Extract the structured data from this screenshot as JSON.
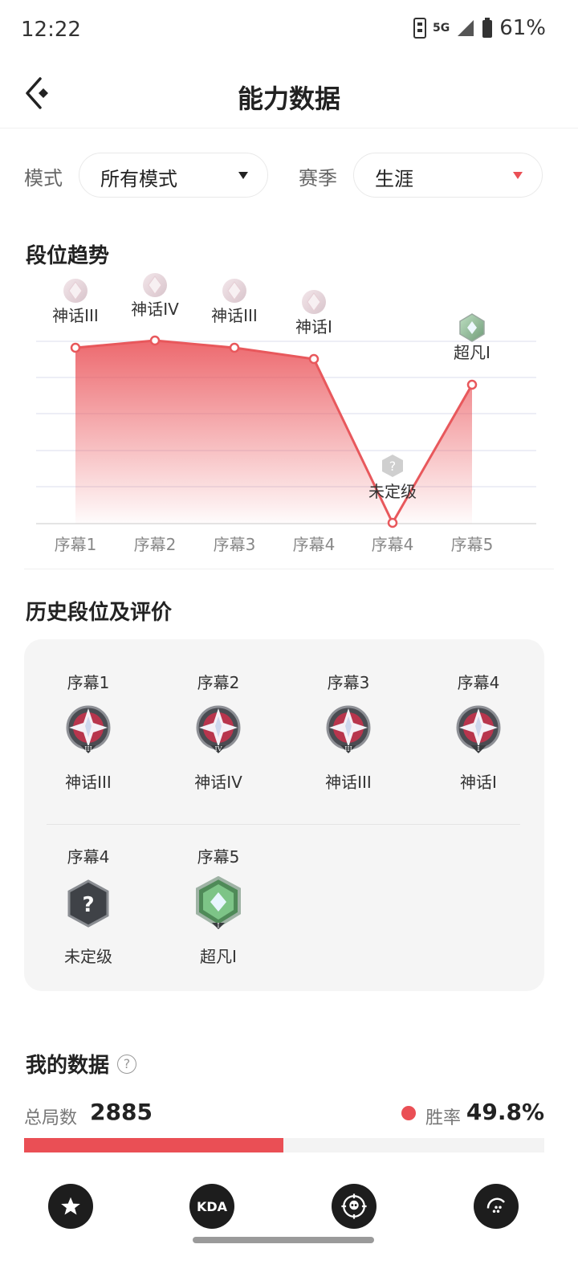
{
  "status_bar": {
    "time": "12:22",
    "network": "5G",
    "battery": "61%"
  },
  "header": {
    "title": "能力数据"
  },
  "filters": {
    "mode_label": "模式",
    "mode_value": "所有模式",
    "season_label": "赛季",
    "season_value": "生涯"
  },
  "trend": {
    "title": "段位趋势",
    "points": [
      {
        "season": "序幕1",
        "rank": "神话III"
      },
      {
        "season": "序幕2",
        "rank": "神话IV"
      },
      {
        "season": "序幕3",
        "rank": "神话III"
      },
      {
        "season": "序幕4",
        "rank": "神话I"
      },
      {
        "season": "序幕4",
        "rank": "未定级"
      },
      {
        "season": "序幕5",
        "rank": "超凡I"
      }
    ]
  },
  "history": {
    "title": "历史段位及评价",
    "items": [
      {
        "season": "序幕1",
        "rank": "神话III",
        "tier": "III",
        "type": "mythic"
      },
      {
        "season": "序幕2",
        "rank": "神话IV",
        "tier": "IV",
        "type": "mythic"
      },
      {
        "season": "序幕3",
        "rank": "神话III",
        "tier": "III",
        "type": "mythic"
      },
      {
        "season": "序幕4",
        "rank": "神话I",
        "tier": "I",
        "type": "mythic"
      },
      {
        "season": "序幕4",
        "rank": "未定级",
        "tier": "",
        "type": "unranked"
      },
      {
        "season": "序幕5",
        "rank": "超凡I",
        "tier": "I",
        "type": "transcend"
      }
    ]
  },
  "my_data": {
    "title": "我的数据",
    "help_glyph": "?",
    "total_label": "总局数",
    "total_value": "2885",
    "winrate_label": "胜率",
    "winrate_value": "49.8%",
    "winrate_fraction": 0.498
  },
  "bottom_tabs": [
    "star-tab",
    "KDA",
    "skull-tab",
    "more-tab"
  ],
  "colors": {
    "accent": "#ea4f55",
    "line": "#e8585c"
  }
}
